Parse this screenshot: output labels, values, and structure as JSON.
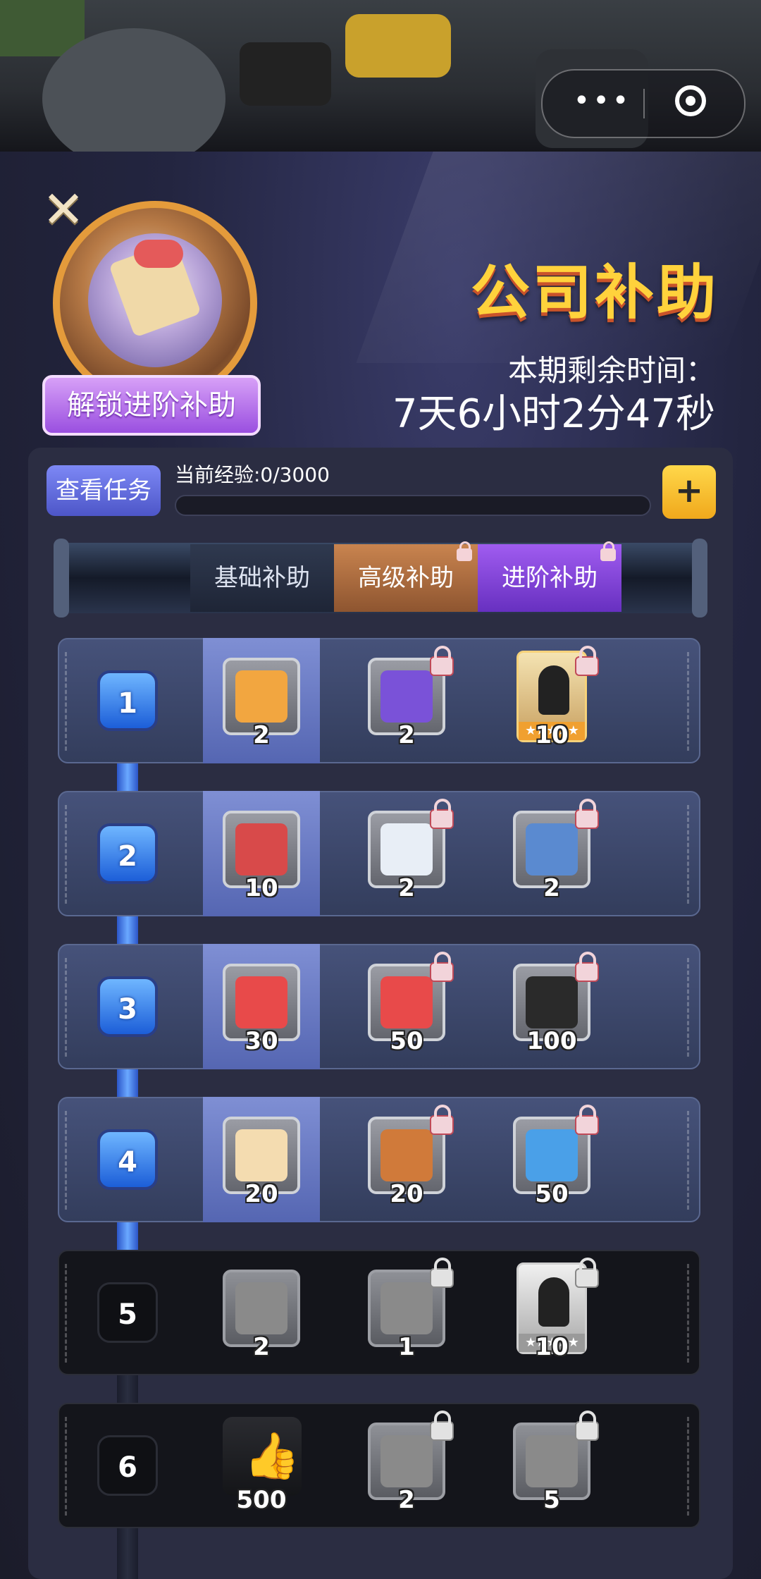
{
  "topbar": {
    "menu_icon": "more-dots-icon",
    "close_icon": "target-circle-icon"
  },
  "header": {
    "title": "公司补助",
    "unlock_label": "解锁进阶补助",
    "time_label": "本期剩余时间：",
    "time_value": "7天6小时2分47秒"
  },
  "exp": {
    "view_tasks_label": "查看任务",
    "label": "当前经验:0/3000",
    "current": 0,
    "max": 3000,
    "add_label": "+"
  },
  "tabs": [
    {
      "label": "基础补助",
      "locked": false
    },
    {
      "label": "高级补助",
      "locked": true
    },
    {
      "label": "进阶补助",
      "locked": true
    }
  ],
  "levels": [
    {
      "level": "1",
      "active": true,
      "rewards": [
        {
          "icon": "orange-ticket-icon",
          "qty": "2",
          "color": "#f2a640"
        },
        {
          "icon": "purple-mystery-card-icon",
          "qty": "2",
          "color": "#7a52d8"
        },
        {
          "icon": "gold-character-card-icon",
          "qty": "10",
          "color": "#f0a030"
        }
      ]
    },
    {
      "level": "2",
      "active": true,
      "rewards": [
        {
          "icon": "newspaper-icon",
          "qty": "10",
          "color": "#d84a4a"
        },
        {
          "icon": "id-card-icon",
          "qty": "2",
          "color": "#e8eef6"
        },
        {
          "icon": "blue-photo-card-icon",
          "qty": "2",
          "color": "#5a8ad0"
        }
      ]
    },
    {
      "level": "3",
      "active": true,
      "rewards": [
        {
          "icon": "gift-box-icon",
          "qty": "30",
          "color": "#e84a4a"
        },
        {
          "icon": "gift-box-icon",
          "qty": "50",
          "color": "#e84a4a"
        },
        {
          "icon": "clapperboard-icon",
          "qty": "100",
          "color": "#2a2a2a"
        }
      ]
    },
    {
      "level": "4",
      "active": true,
      "rewards": [
        {
          "icon": "contract-scroll-icon",
          "qty": "20",
          "color": "#f4dcb0"
        },
        {
          "icon": "poster-icon",
          "qty": "20",
          "color": "#d07a3a"
        },
        {
          "icon": "colorful-album-icon",
          "qty": "50",
          "color": "#4aa0e8"
        }
      ]
    },
    {
      "level": "5",
      "active": false,
      "rewards": [
        {
          "icon": "grey-mystery-card-icon",
          "qty": "2",
          "color": "#8a8a8a"
        },
        {
          "icon": "grey-mystery-card-icon",
          "qty": "1",
          "color": "#8a8a8a"
        },
        {
          "icon": "silver-character-card-icon",
          "qty": "10",
          "color": "#bdbdbd"
        }
      ]
    },
    {
      "level": "6",
      "active": false,
      "rewards": [
        {
          "icon": "thumbs-up-icon",
          "qty": "500",
          "color": "#e8e8e8"
        },
        {
          "icon": "grey-mystery-card-icon",
          "qty": "2",
          "color": "#8a8a8a"
        },
        {
          "icon": "clover-card-icon",
          "qty": "5",
          "color": "#8a8a8a"
        }
      ]
    }
  ]
}
